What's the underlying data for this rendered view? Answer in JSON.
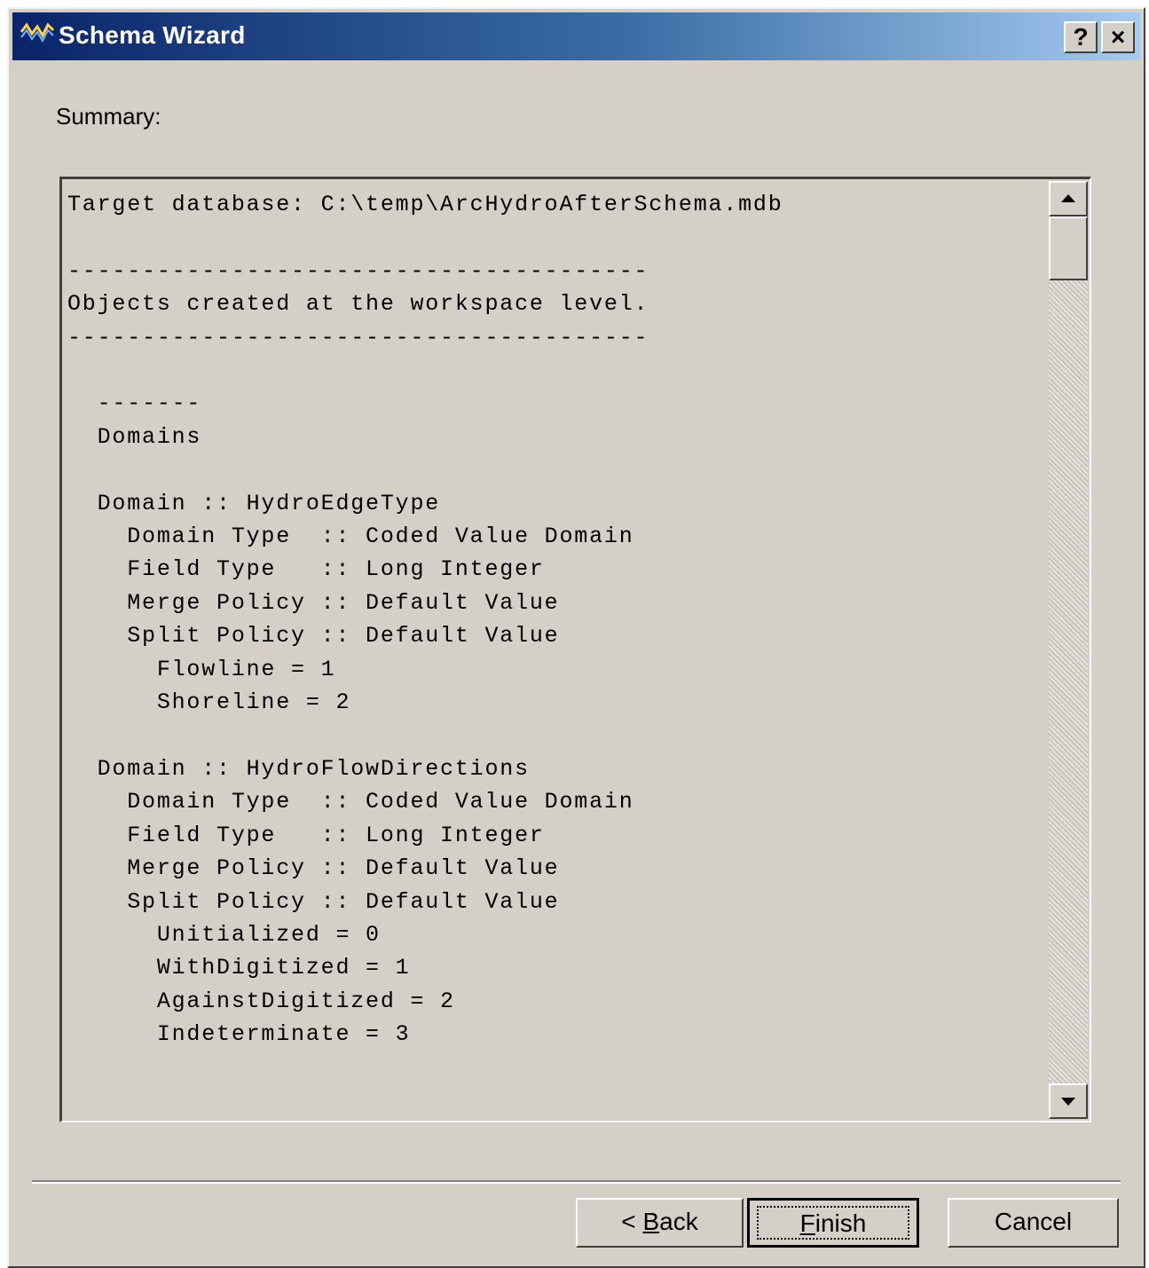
{
  "window": {
    "title": "Schema Wizard",
    "app_icon": "wave-graph-icon",
    "help_label": "?",
    "close_label": "×"
  },
  "summary": {
    "label": "Summary:",
    "text": "Target database: C:\\temp\\ArcHydroAfterSchema.mdb\n\n---------------------------------------\nObjects created at the workspace level.\n---------------------------------------\n\n  -------\n  Domains\n\n  Domain :: HydroEdgeType\n    Domain Type  :: Coded Value Domain\n    Field Type   :: Long Integer\n    Merge Policy :: Default Value\n    Split Policy :: Default Value\n      Flowline = 1\n      Shoreline = 2\n\n  Domain :: HydroFlowDirections\n    Domain Type  :: Coded Value Domain\n    Field Type   :: Long Integer\n    Merge Policy :: Default Value\n    Split Policy :: Default Value\n      Unitialized = 0\n      WithDigitized = 1\n      AgainstDigitized = 2\n      Indeterminate = 3"
  },
  "buttons": {
    "back_prefix": "< ",
    "back_accel": "B",
    "back_rest": "ack",
    "finish_accel": "F",
    "finish_rest": "inish",
    "cancel": "Cancel"
  }
}
